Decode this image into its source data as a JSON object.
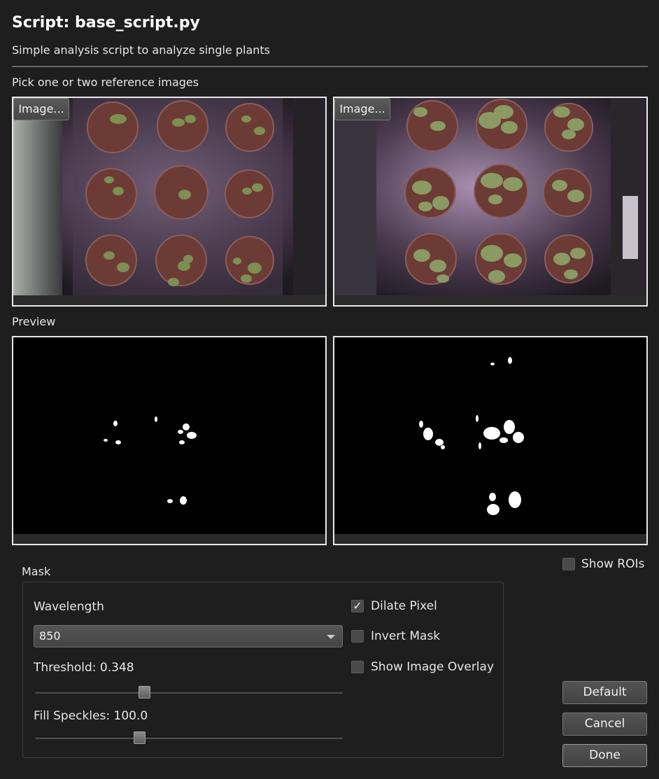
{
  "dialog": {
    "title": "Script: base_script.py",
    "subtitle": "Simple analysis script to analyze single plants"
  },
  "reference": {
    "label": "Pick one or two reference images",
    "left_button": "Image...",
    "right_button": "Image..."
  },
  "preview": {
    "label": "Preview"
  },
  "mask": {
    "group_label": "Mask",
    "wavelength_label": "Wavelength",
    "wavelength_value": "850",
    "threshold_label": "Threshold: 0.348",
    "threshold_value": 0.348,
    "fill_speckles_label": "Fill Speckles: 100.0",
    "fill_speckles_value": 100.0,
    "dilate_pixel_label": "Dilate Pixel",
    "dilate_pixel_checked": true,
    "invert_mask_label": "Invert Mask",
    "invert_mask_checked": false,
    "show_overlay_label": "Show Image Overlay",
    "show_overlay_checked": false
  },
  "show_rois": {
    "label": "Show ROIs",
    "checked": false
  },
  "buttons": {
    "default": "Default",
    "cancel": "Cancel",
    "done": "Done"
  }
}
